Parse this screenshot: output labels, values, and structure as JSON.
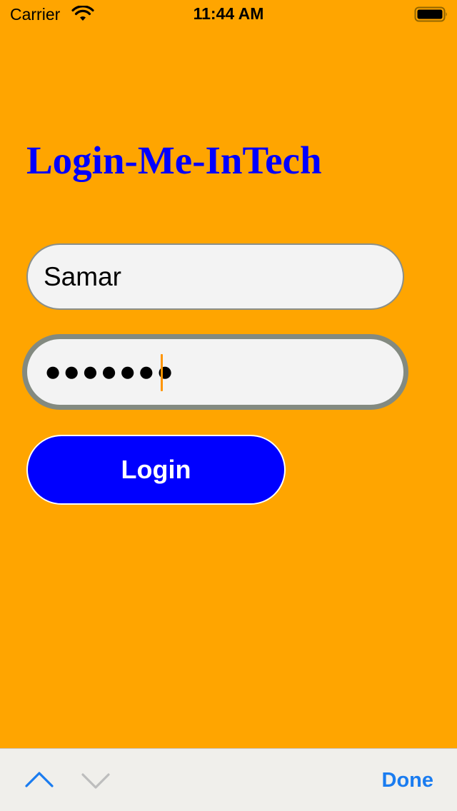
{
  "status_bar": {
    "carrier": "Carrier",
    "time": "11:44 AM",
    "wifi_icon": "wifi-icon",
    "battery_icon": "battery-icon"
  },
  "app": {
    "title": "Login-Me-InTech",
    "title_color": "#0000FF",
    "background_color": "#FFA500"
  },
  "form": {
    "username_value": "Samar",
    "password_masked": "●●●●●●●",
    "login_label": "Login",
    "login_button_color": "#0000FF"
  },
  "keyboard_toolbar": {
    "prev_icon": "chevron-up-icon",
    "next_icon": "chevron-down-icon",
    "done_label": "Done",
    "accent_color": "#1A7CF0"
  }
}
